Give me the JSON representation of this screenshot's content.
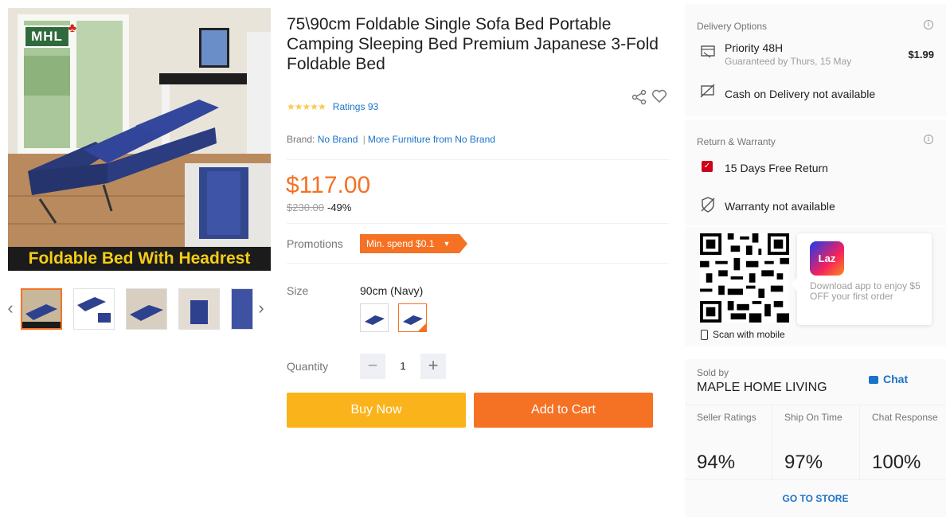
{
  "gallery": {
    "logo_text": "MHL",
    "banner_text": "Foldable Bed With Headrest",
    "thumbnail_count": 5,
    "active_thumbnail": 1
  },
  "product": {
    "title": "75\\90cm Foldable Single Sofa Bed Portable Camping Sleeping Bed Premium Japanese 3-Fold Foldable Bed",
    "rating_stars": 4.5,
    "ratings_label": "Ratings 93",
    "brand_label": "Brand:",
    "brand_name": "No Brand",
    "brand_more": "More Furniture from No Brand",
    "price": "$117.00",
    "original_price": "$230.00",
    "discount": "-49%",
    "promotions_label": "Promotions",
    "promotion_tag": "Min. spend $0.1",
    "size_label": "Size",
    "size_value": "90cm (Navy)",
    "quantity_label": "Quantity",
    "quantity": "1",
    "buy_now": "Buy Now",
    "add_to_cart": "Add to Cart"
  },
  "delivery": {
    "title": "Delivery Options",
    "option_name": "Priority 48H",
    "option_sub": "Guaranteed by Thurs, 15 May",
    "option_price": "$1.99",
    "cod_text": "Cash on Delivery not available"
  },
  "warranty": {
    "title": "Return & Warranty",
    "return_text": "15 Days Free Return",
    "warranty_text": "Warranty not available"
  },
  "app_promo": {
    "logo_text": "Laz",
    "text": "Download app to enjoy $5 OFF your first order",
    "scan_text": "Scan with mobile"
  },
  "seller": {
    "sold_by_label": "Sold by",
    "name": "MAPLE HOME LIVING",
    "chat_label": "Chat",
    "stats": [
      {
        "label": "Seller Ratings",
        "value": "94%"
      },
      {
        "label": "Ship On Time",
        "value": "97%"
      },
      {
        "label": "Chat Response",
        "value": "100%"
      }
    ],
    "go_store": "GO TO STORE"
  },
  "colors": {
    "accent_orange": "#f57224",
    "buy_yellow": "#fbb31c",
    "link_blue": "#1a73c8"
  }
}
